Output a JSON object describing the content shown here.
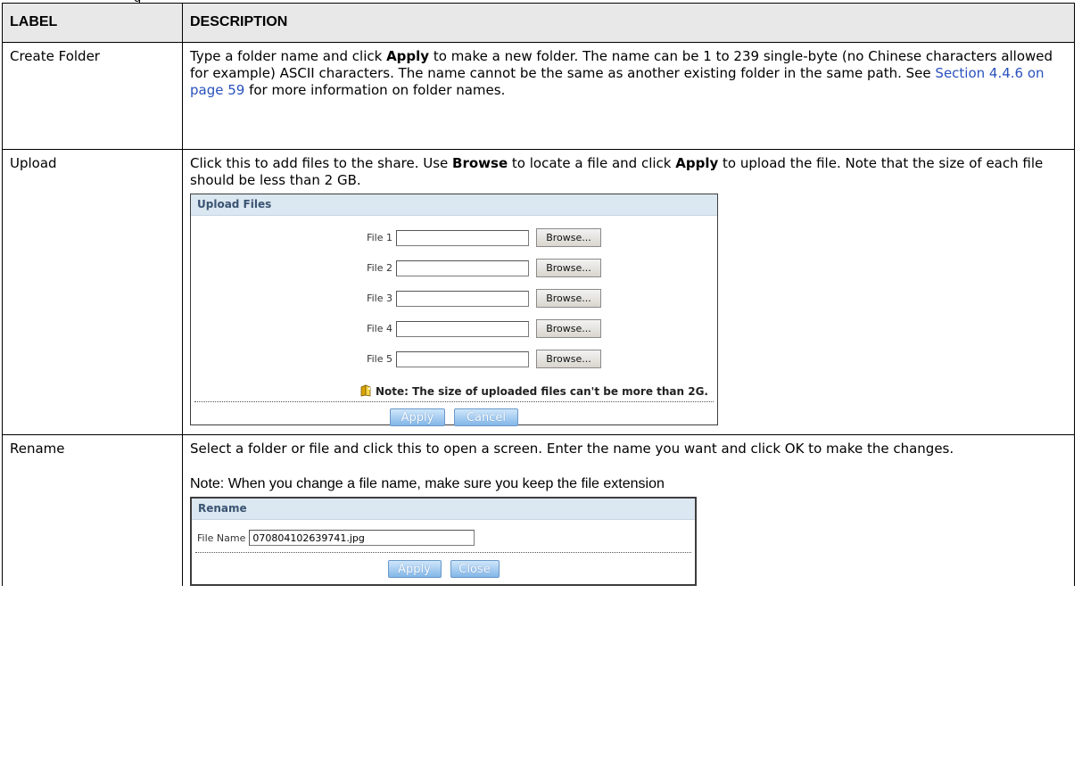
{
  "caption_fragment": "g",
  "table": {
    "headers": {
      "label": "LABEL",
      "description": "DESCRIPTION"
    },
    "rows": [
      {
        "label": "Create Folder",
        "desc_1": "Type a folder name and click ",
        "desc_bold_1": "Apply",
        "desc_2": " to make a new folder. The name can be 1 to 239 single-byte (no Chinese characters allowed for example) ASCII characters. The name cannot be the same as another existing folder in the same path. See ",
        "desc_link": "Section 4.4.6 on page 59",
        "desc_3": " for more information on folder names."
      },
      {
        "label": "Upload",
        "desc_1": "Click this to add files to the share. Use ",
        "desc_bold_1": "Browse",
        "desc_2": " to locate a file and click ",
        "desc_bold_2": "Apply",
        "desc_3": " to upload the file. Note that the size of each file should be less than 2 GB."
      },
      {
        "label": "Rename",
        "desc_1": "Select a folder or file and click this to open a screen. Enter the name you want and click OK to make the changes.",
        "note": "Note: When you change a file name, make sure you keep the file extension"
      }
    ]
  },
  "upload_dialog": {
    "title": "Upload Files",
    "files": [
      {
        "label": "File 1",
        "value": "",
        "button": "Browse..."
      },
      {
        "label": "File 2",
        "value": "",
        "button": "Browse..."
      },
      {
        "label": "File 3",
        "value": "",
        "button": "Browse..."
      },
      {
        "label": "File 4",
        "value": "",
        "button": "Browse..."
      },
      {
        "label": "File 5",
        "value": "",
        "button": "Browse..."
      }
    ],
    "note": "Note: The size of uploaded files can't be more than 2G.",
    "apply_label": "Apply",
    "cancel_label": "Cancel"
  },
  "rename_dialog": {
    "title": "Rename",
    "field_label": "File Name",
    "field_value": "070804102639741.jpg",
    "apply_label": "Apply",
    "close_label": "Close"
  },
  "colors": {
    "dialog_title_bg": "#dbe7f1",
    "dialog_title_text": "#3a5372",
    "blue_button": "#83b6e8",
    "link": "#2a52be"
  }
}
